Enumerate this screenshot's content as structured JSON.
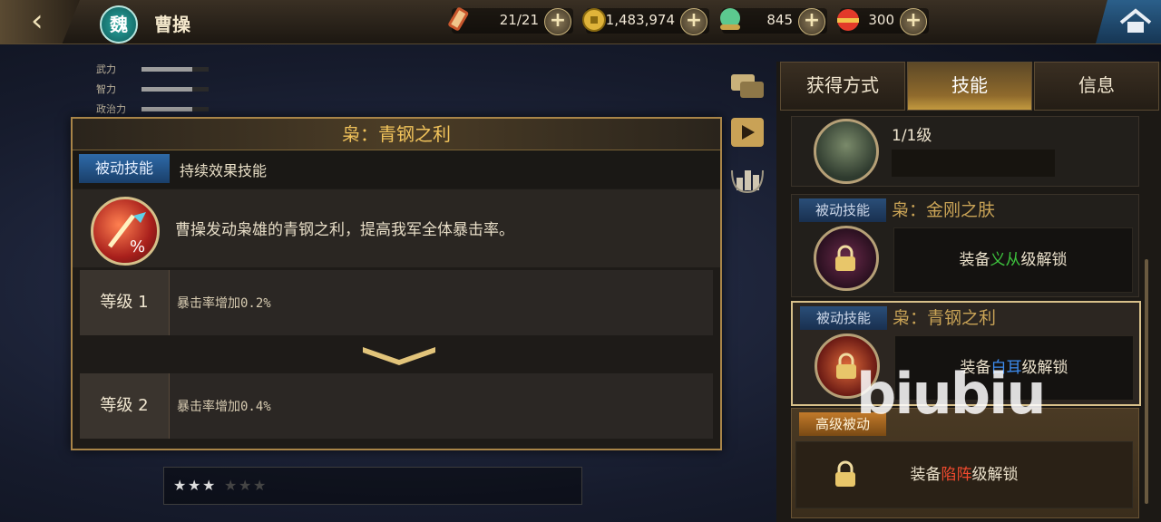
{
  "topbar": {
    "back_icon": "chevron-left-icon",
    "faction": "魏",
    "hero_name": "曹操",
    "resources": [
      {
        "name": "scroll-icon",
        "value": "21/21"
      },
      {
        "name": "coin-icon",
        "value": "1,483,974"
      },
      {
        "name": "jade-icon",
        "value": "845"
      },
      {
        "name": "gem-icon",
        "value": "300"
      }
    ],
    "home_icon": "home-icon"
  },
  "stats": [
    {
      "label": "武力",
      "level": 0.75
    },
    {
      "label": "智力",
      "level": 0.75
    },
    {
      "label": "政治力",
      "level": 0.75
    }
  ],
  "popup": {
    "title": "枭：青钢之利",
    "type_tag": "被动技能",
    "type_sub": "持续效果技能",
    "description": "曹操发动枭雄的青钢之利，提高我军全体暴击率。",
    "levels": [
      {
        "label": "等级 1",
        "text": "暴击率增加0.2%"
      },
      {
        "label": "等级 2",
        "text": "暴击率增加0.4%"
      }
    ]
  },
  "starbar": {
    "stars_filled": 3,
    "stars_total": 6
  },
  "tabs": [
    {
      "label": "获得方式",
      "active": false
    },
    {
      "label": "技能",
      "active": true
    },
    {
      "label": "信息",
      "active": false
    }
  ],
  "skills": {
    "top_level": "1/1级",
    "card1": {
      "tag": "被动技能",
      "name": "枭：金刚之肤",
      "unlock_pre": "装备",
      "unlock_key": "义从",
      "unlock_post": "级解锁",
      "key_color": "#3ec43e"
    },
    "card2": {
      "tag": "被动技能",
      "name": "枭：青钢之利",
      "unlock_pre": "装备",
      "unlock_key": "白耳",
      "unlock_post": "级解锁",
      "key_color": "#3d8cf0"
    },
    "card3": {
      "tag": "高级被动",
      "unlock_pre": "装备",
      "unlock_key": "陷阵",
      "unlock_post": "级解锁",
      "key_color": "#f04a2e"
    }
  },
  "watermark": "biubiu"
}
